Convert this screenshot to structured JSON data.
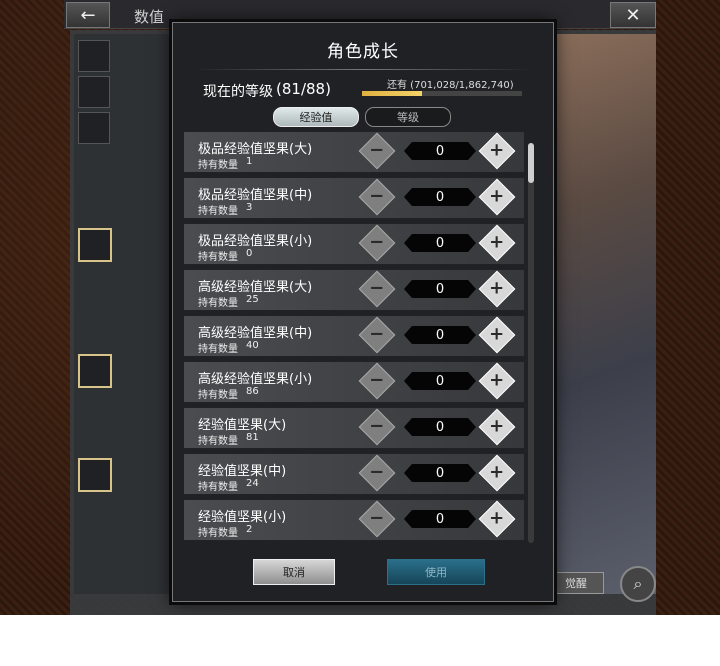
{
  "header": {
    "screen_title": "数值",
    "back_icon": "back-arrow-icon",
    "close_icon": "close-x-icon"
  },
  "dialog": {
    "title": "角色成长",
    "level_label": "现在的等级",
    "level_value": "(81/88)",
    "exp_text": "还有 (701,028/1,862,740)",
    "exp_progress": 0.376,
    "tabs": [
      {
        "label": "经验值",
        "active": true
      },
      {
        "label": "等级",
        "active": false
      }
    ],
    "count_label": "持有数量",
    "items": [
      {
        "name": "极品经验值坚果(大)",
        "count": "1",
        "qty": "0"
      },
      {
        "name": "极品经验值坚果(中)",
        "count": "3",
        "qty": "0"
      },
      {
        "name": "极品经验值坚果(小)",
        "count": "0",
        "qty": "0"
      },
      {
        "name": "高级经验值坚果(大)",
        "count": "25",
        "qty": "0"
      },
      {
        "name": "高级经验值坚果(中)",
        "count": "40",
        "qty": "0"
      },
      {
        "name": "高级经验值坚果(小)",
        "count": "86",
        "qty": "0"
      },
      {
        "name": "经验值坚果(大)",
        "count": "81",
        "qty": "0"
      },
      {
        "name": "经验值坚果(中)",
        "count": "24",
        "qty": "0"
      },
      {
        "name": "经验值坚果(小)",
        "count": "2",
        "qty": "0"
      }
    ],
    "cancel_label": "取消",
    "use_label": "使用"
  },
  "background": {
    "awaken_label": "觉醒",
    "search_icon": "magnifier-icon"
  }
}
